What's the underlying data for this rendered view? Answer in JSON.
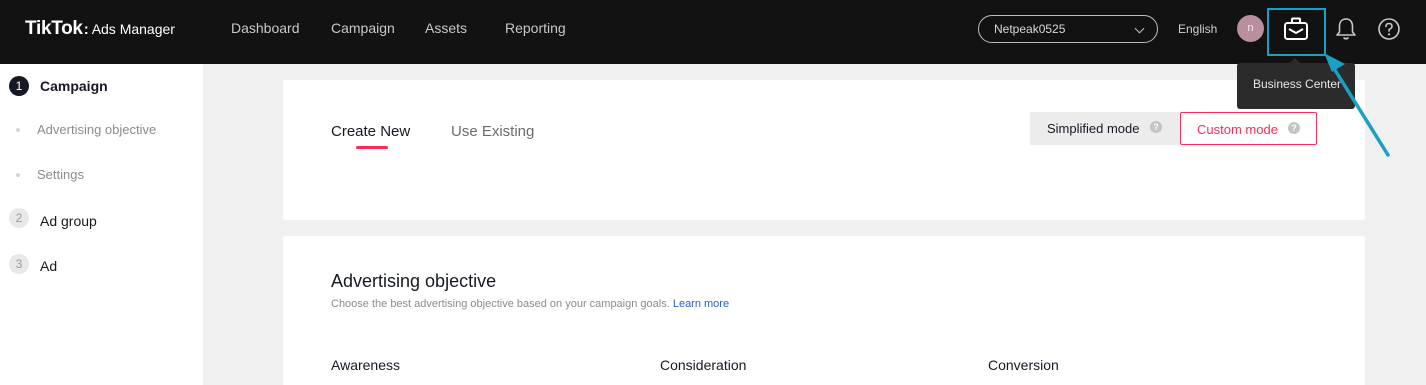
{
  "header": {
    "logo_main": "TikTok",
    "logo_colon": ":",
    "logo_sub": "Ads Manager",
    "nav": [
      "Dashboard",
      "Campaign",
      "Assets",
      "Reporting"
    ],
    "account": "Netpeak0525",
    "language": "English",
    "avatar_initial": "n",
    "icons": [
      "business-center-icon",
      "bell-icon",
      "help-icon"
    ]
  },
  "tooltip": {
    "text": "Business Center"
  },
  "sidebar": {
    "steps": [
      {
        "number": "1",
        "label": "Campaign",
        "active": true
      },
      {
        "number": "2",
        "label": "Ad group",
        "active": false
      },
      {
        "number": "3",
        "label": "Ad",
        "active": false
      }
    ],
    "substeps": [
      "Advertising objective",
      "Settings"
    ]
  },
  "create": {
    "tabs": [
      "Create New",
      "Use Existing"
    ],
    "modes": {
      "simplified": "Simplified mode",
      "custom": "Custom mode",
      "help_glyph": "?"
    }
  },
  "objective": {
    "title": "Advertising objective",
    "description": "Choose the best advertising objective based on your campaign goals.",
    "link": "Learn more",
    "columns": [
      "Awareness",
      "Consideration",
      "Conversion"
    ]
  },
  "colors": {
    "accent": "#fe2c55",
    "highlight": "#1aa0c4",
    "header_bg": "#121212"
  }
}
